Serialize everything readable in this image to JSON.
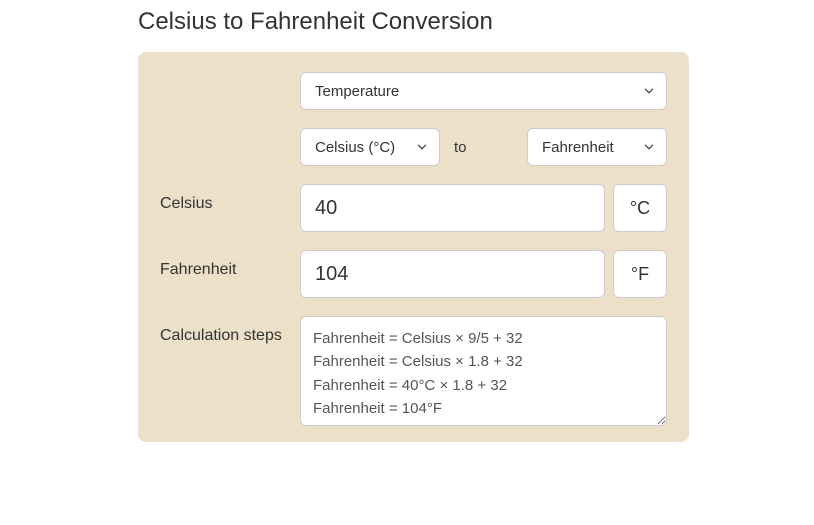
{
  "title": "Celsius to Fahrenheit Conversion",
  "category_select": {
    "value": "Temperature"
  },
  "from_unit_select": {
    "value": "Celsius (°C)"
  },
  "to_label": "to",
  "to_unit_select": {
    "value": "Fahrenheit"
  },
  "celsius": {
    "label": "Celsius",
    "value": "40",
    "unit": "°C"
  },
  "fahrenheit": {
    "label": "Fahrenheit",
    "value": "104",
    "unit": "°F"
  },
  "steps": {
    "label": "Calculation steps",
    "text": "Fahrenheit = Celsius × 9/5 + 32\nFahrenheit = Celsius × 1.8 + 32\nFahrenheit = 40°C × 1.8 + 32\nFahrenheit = 104°F"
  }
}
